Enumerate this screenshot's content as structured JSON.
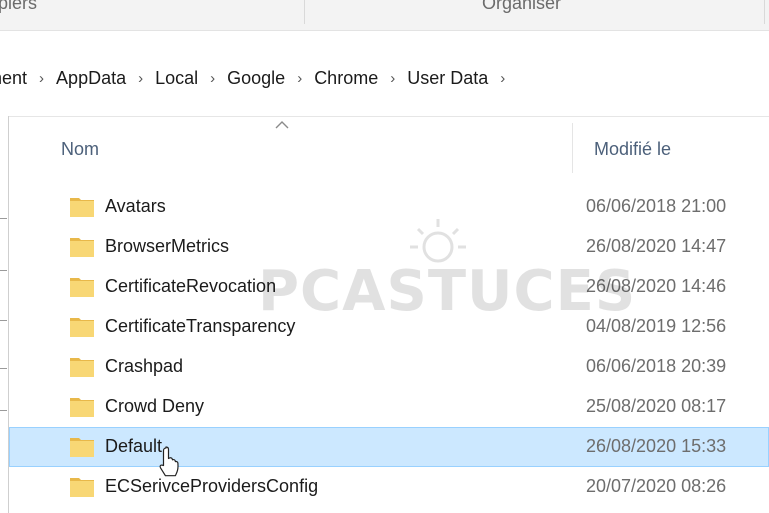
{
  "ribbon": {
    "group_left": "piers",
    "group_center": "Organiser"
  },
  "address_bar": {
    "crumbs": [
      "nent",
      "AppData",
      "Local",
      "Google",
      "Chrome",
      "User Data"
    ]
  },
  "columns": {
    "name": "Nom",
    "modified": "Modifié le"
  },
  "files": [
    {
      "name": "Avatars",
      "modified": "06/06/2018 21:00"
    },
    {
      "name": "BrowserMetrics",
      "modified": "26/08/2020 14:47"
    },
    {
      "name": "CertificateRevocation",
      "modified": "26/08/2020 14:46"
    },
    {
      "name": "CertificateTransparency",
      "modified": "04/08/2019 12:56"
    },
    {
      "name": "Crashpad",
      "modified": "06/06/2018 20:39"
    },
    {
      "name": "Crowd Deny",
      "modified": "25/08/2020 08:17"
    },
    {
      "name": "Default",
      "modified": "26/08/2020 15:33",
      "selected": true
    },
    {
      "name": "ECSerivceProvidersConfig",
      "modified": "20/07/2020 08:26"
    }
  ],
  "watermark": "PCASTUCES",
  "colors": {
    "selection_bg": "#cce8ff",
    "selection_border": "#99d1ff",
    "folder": "#f8d775",
    "header_text": "#4c607a"
  }
}
